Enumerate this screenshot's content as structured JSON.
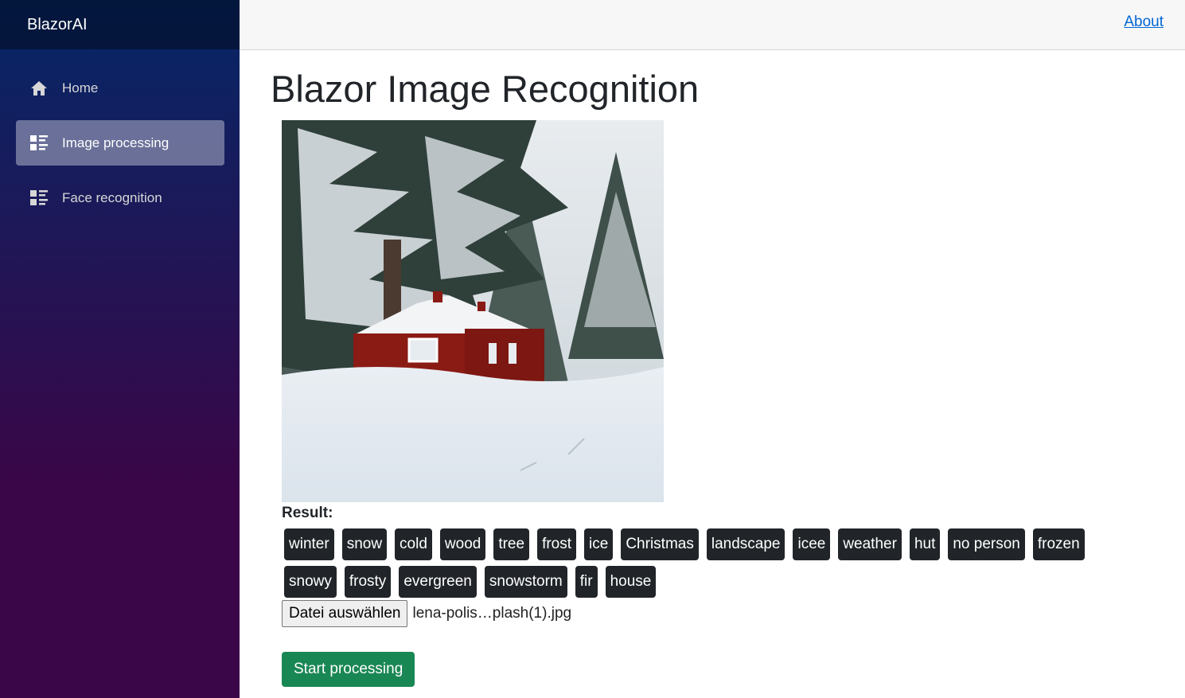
{
  "app": {
    "brand": "BlazorAI"
  },
  "sidebar": {
    "items": [
      {
        "label": "Home",
        "icon": "home-icon",
        "active": false
      },
      {
        "label": "Image processing",
        "icon": "list-rich-icon",
        "active": true
      },
      {
        "label": "Face recognition",
        "icon": "list-rich-icon",
        "active": false
      }
    ]
  },
  "topbar": {
    "about_link": "About"
  },
  "main": {
    "title": "Blazor Image Recognition",
    "result_label": "Result:",
    "tags": [
      "winter",
      "snow",
      "cold",
      "wood",
      "tree",
      "frost",
      "ice",
      "Christmas",
      "landscape",
      "icee",
      "weather",
      "hut",
      "no person",
      "frozen",
      "snowy",
      "frosty",
      "evergreen",
      "snowstorm",
      "fir",
      "house"
    ],
    "file_button": "Datei auswählen",
    "file_name": "lena-polis…plash(1).jpg",
    "start_button": "Start processing"
  },
  "colors": {
    "accent_green": "#198754",
    "tag_bg": "#212529",
    "link": "#0366d6"
  }
}
